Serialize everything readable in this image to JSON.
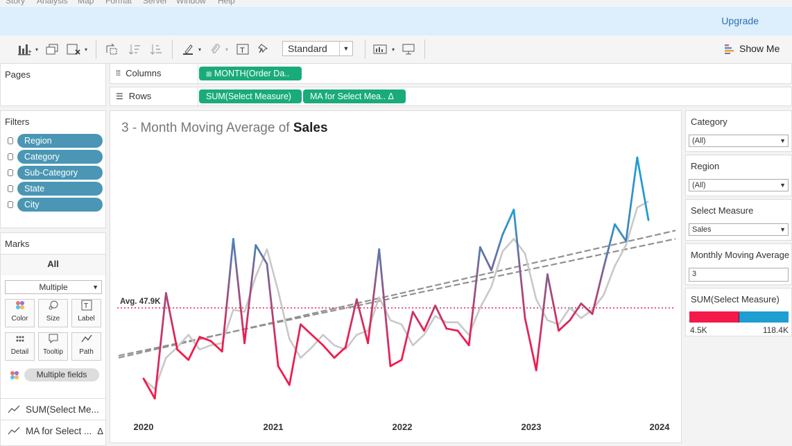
{
  "menu": [
    "Story",
    "Analysis",
    "Map",
    "Format",
    "Server",
    "Window",
    "Help"
  ],
  "banner": {
    "upgrade": "Upgrade"
  },
  "toolbar": {
    "fit": "Standard",
    "show_me": "Show Me"
  },
  "pages": {
    "title": "Pages"
  },
  "shelves": {
    "columns_label": "Columns",
    "rows_label": "Rows",
    "columns_pills": [
      "MONTH(Order Da.."
    ],
    "rows_pills": [
      "SUM(Select Measure)",
      "MA for Select Mea.. Δ"
    ]
  },
  "filters": {
    "title": "Filters",
    "items": [
      "Region",
      "Category",
      "Sub-Category",
      "State",
      "City"
    ]
  },
  "marks": {
    "title": "Marks",
    "all": "All",
    "type": "Multiple",
    "buttons": [
      "Color",
      "Size",
      "Label",
      "Detail",
      "Tooltip",
      "Path"
    ],
    "multiple_fields": "Multiple fields",
    "cards": [
      "SUM(Select Me...",
      "MA for Select ..."
    ],
    "delta": "Δ"
  },
  "right_panel": {
    "category": {
      "label": "Category",
      "value": "(All)"
    },
    "region": {
      "label": "Region",
      "value": "(All)"
    },
    "measure": {
      "label": "Select Measure",
      "value": "Sales"
    },
    "moving_avg": {
      "label": "Monthly Moving Average",
      "value": "3"
    },
    "legend": {
      "label": "SUM(Select Measure)",
      "min": "4.5K",
      "max": "118.4K"
    }
  },
  "colors": {
    "low": "#f5184b",
    "high": "#1f9ed1",
    "ma_line": "#c8c8c8",
    "trend": "#909090",
    "avg_line": "#e8224f",
    "green_pill": "#1aab7a",
    "blue_pill": "#4a96b4"
  },
  "chart_data": {
    "type": "line",
    "title_prefix": "3 - Month Moving Average of ",
    "title_measure": "Sales",
    "x_ticks": [
      "2020",
      "2021",
      "2022",
      "2023",
      "2024"
    ],
    "ylim": [
      0,
      125000
    ],
    "average": 47900,
    "average_label": "Avg. 47.9K",
    "series": [
      {
        "role": "measure",
        "values": [
          14000,
          4500,
          55000,
          28000,
          23000,
          34000,
          32000,
          27000,
          81000,
          31000,
          78000,
          69000,
          20000,
          11000,
          40000,
          35000,
          30000,
          24000,
          29000,
          52000,
          31000,
          76000,
          20000,
          23000,
          46000,
          37000,
          49000,
          38000,
          37000,
          30000,
          77000,
          66000,
          83000,
          95000,
          43000,
          18000,
          64000,
          37000,
          42000,
          50000,
          45000,
          67000,
          88000,
          80000,
          120000,
          90000
        ]
      },
      {
        "role": "moving_average",
        "values": [
          14000,
          9000,
          24000,
          29000,
          35000,
          28000,
          30000,
          31000,
          47000,
          46000,
          63000,
          76000,
          56000,
          33000,
          24000,
          29000,
          35000,
          30000,
          28000,
          35000,
          37000,
          53000,
          42000,
          40000,
          30000,
          35000,
          44000,
          41000,
          41000,
          35000,
          48000,
          58000,
          75000,
          81000,
          74000,
          52000,
          42000,
          40000,
          48000,
          43000,
          47000,
          54000,
          68000,
          78000,
          96000,
          99000
        ]
      },
      {
        "role": "trend",
        "values": [
          24000,
          85000
        ]
      },
      {
        "role": "trend",
        "values": [
          25000,
          81000
        ]
      }
    ]
  }
}
